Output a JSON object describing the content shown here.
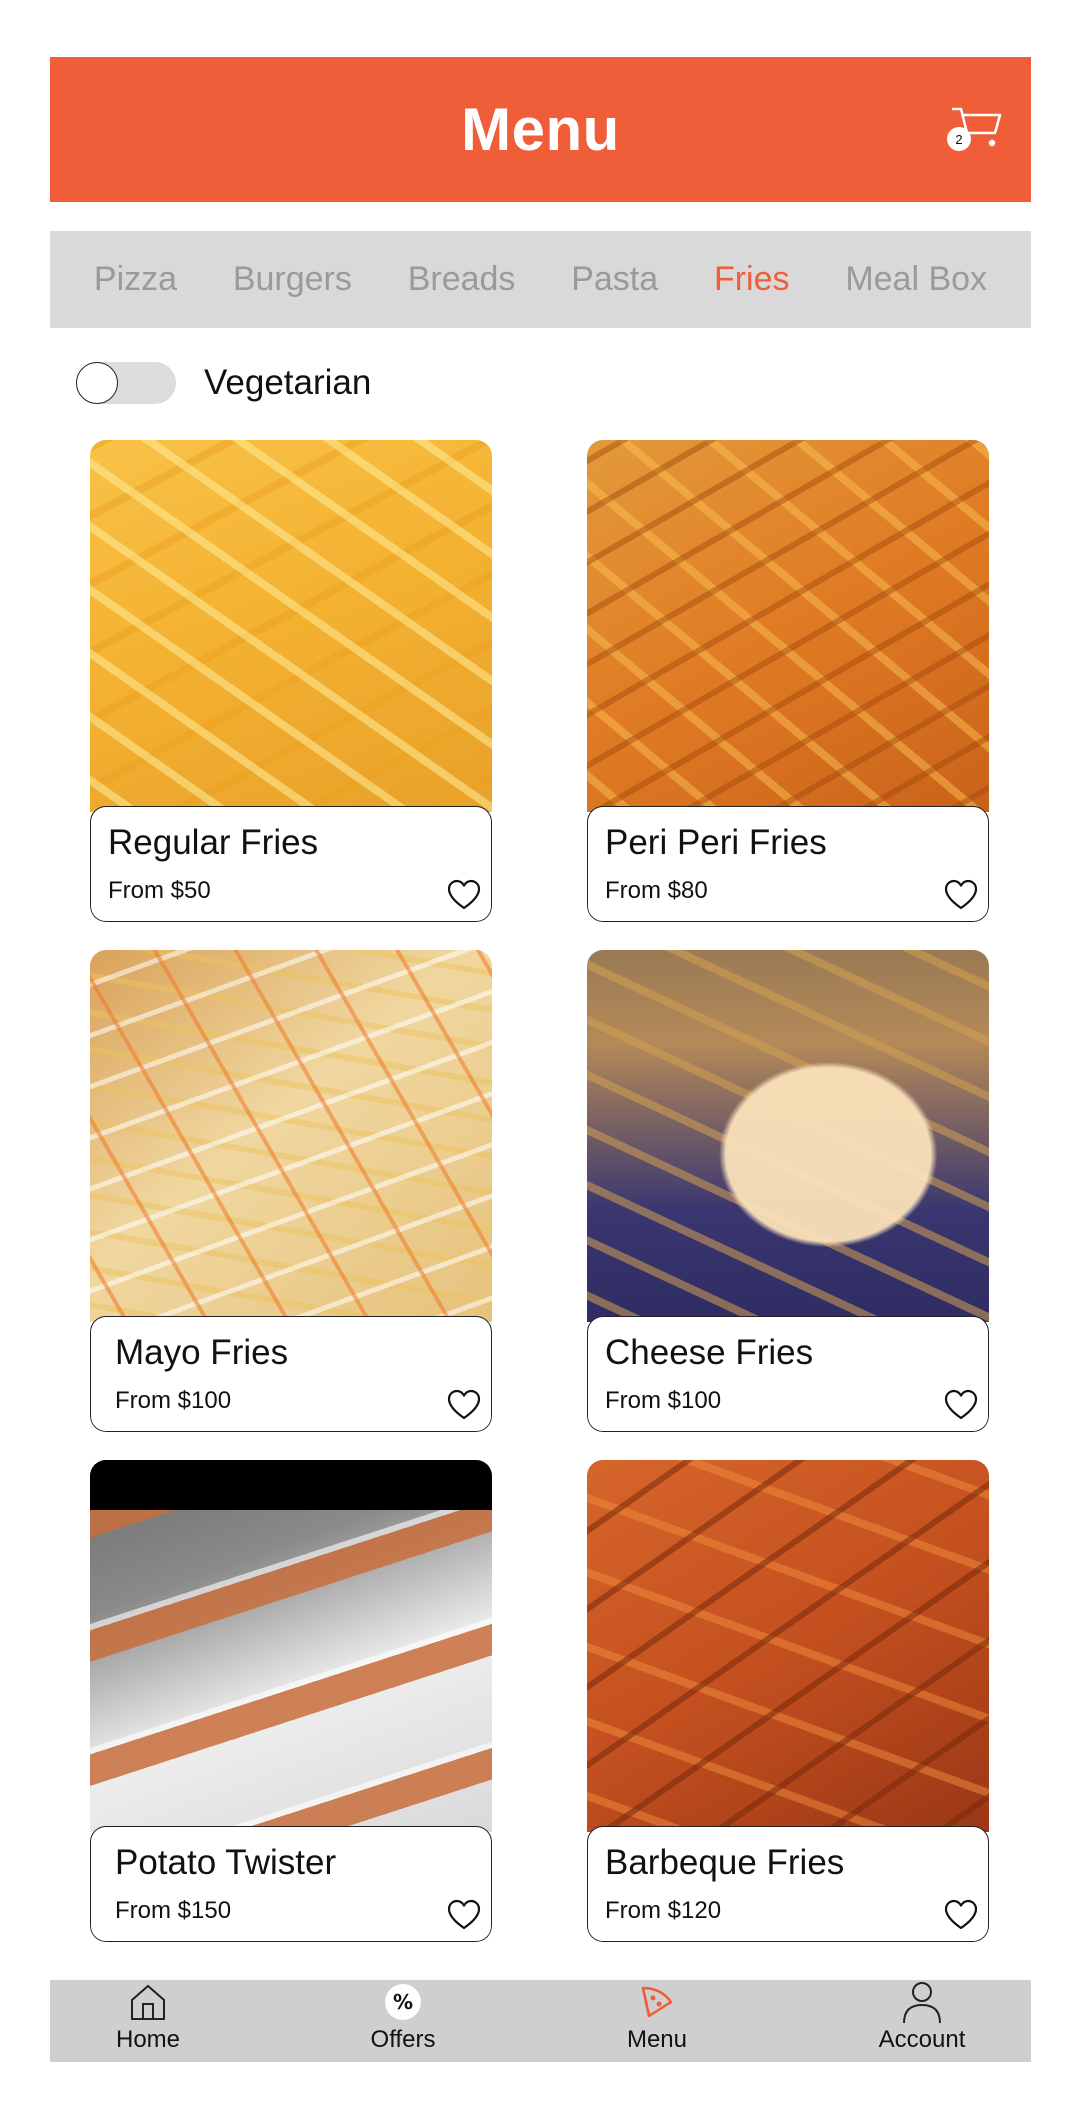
{
  "header": {
    "title": "Menu",
    "cart_count": "2"
  },
  "tabs": [
    {
      "label": "Pizza"
    },
    {
      "label": "Burgers"
    },
    {
      "label": "Breads"
    },
    {
      "label": "Pasta"
    },
    {
      "label": "Fries"
    },
    {
      "label": "Meal Box"
    }
  ],
  "active_tab": "Fries",
  "filter": {
    "label": "Vegetarian",
    "enabled": false
  },
  "items": [
    {
      "name": "Regular Fries",
      "price": "From $50"
    },
    {
      "name": "Peri Peri Fries",
      "price": "From $80"
    },
    {
      "name": "Mayo Fries",
      "price": "From $100"
    },
    {
      "name": "Cheese Fries",
      "price": "From $100"
    },
    {
      "name": "Potato Twister",
      "price": "From $150"
    },
    {
      "name": "Barbeque Fries",
      "price": "From $120"
    }
  ],
  "bottom_nav": [
    {
      "label": "Home",
      "icon": "home-icon"
    },
    {
      "label": "Offers",
      "icon": "percent-icon"
    },
    {
      "label": "Menu",
      "icon": "pizza-slice-icon"
    },
    {
      "label": "Account",
      "icon": "user-icon"
    }
  ],
  "colors": {
    "accent": "#f05d39",
    "tab_bar": "#d9d9d9",
    "nav_bar": "#cfcfcf"
  }
}
